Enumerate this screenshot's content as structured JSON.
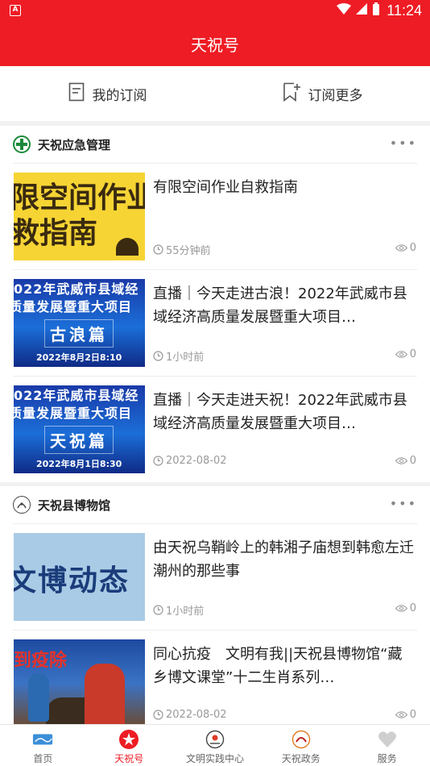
{
  "status_bar": {
    "time": "11:24"
  },
  "header": {
    "title": "天祝号"
  },
  "tabs": [
    {
      "label": "我的订阅"
    },
    {
      "label": "订阅更多"
    }
  ],
  "sections": [
    {
      "name": "天祝应急管理",
      "items": [
        {
          "title": "有限空间作业自救指南",
          "time": "55分钟前",
          "views": "0",
          "thumb_text": "限空间作业 救指南"
        },
        {
          "title": "直播｜今天走进古浪！2022年武威市县域经济高质量发展暨重大项目…",
          "time": "1小时前",
          "views": "0",
          "thumb_band": "022年武威市县域经",
          "thumb_band2": "质量发展暨重大项目",
          "thumb_big": "古浪篇",
          "thumb_date": "2022年8月2日8:10"
        },
        {
          "title": "直播｜今天走进天祝！2022年武威市县域经济高质量发展暨重大项目…",
          "time": "2022-08-02",
          "views": "0",
          "thumb_band": "022年武威市县域经",
          "thumb_band2": "质量发展暨重大项目",
          "thumb_big": "天祝篇",
          "thumb_date": "2022年8月1日8:30"
        }
      ]
    },
    {
      "name": "天祝县博物馆",
      "items": [
        {
          "title": "由天祝乌鞘岭上的韩湘子庙想到韩愈左迁潮州的那些事",
          "time": "1小时前",
          "views": "0",
          "thumb_text": "文博动态"
        },
        {
          "title": "同心抗疫　文明有我||天祝县博物馆“藏乡博文课堂”十二生肖系列…",
          "time": "2022-08-02",
          "views": "0",
          "thumb_text": "到疫除"
        }
      ]
    }
  ],
  "bottom_nav": [
    {
      "label": "首页",
      "icon": "home-icon"
    },
    {
      "label": "天祝号",
      "icon": "star-badge-icon",
      "active": true
    },
    {
      "label": "文明实践中心",
      "icon": "emblem-icon"
    },
    {
      "label": "天祝政务",
      "icon": "gov-icon"
    },
    {
      "label": "服务",
      "icon": "heart-icon"
    }
  ],
  "colors": {
    "brand_red": "#ee1c24"
  }
}
